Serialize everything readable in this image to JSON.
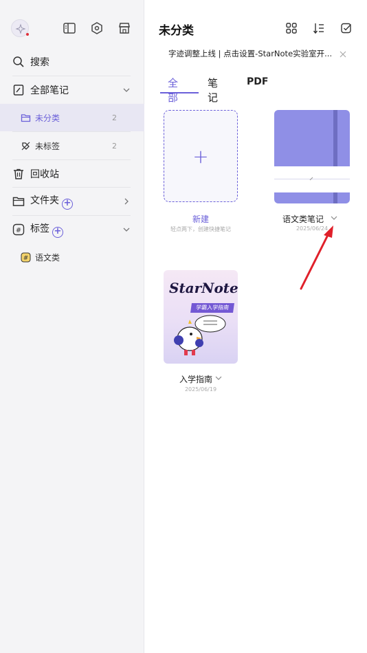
{
  "sidebar": {
    "search_label": "搜索",
    "all_notes_label": "全部笔记",
    "uncategorized": {
      "label": "未分类",
      "count": "2"
    },
    "unlabeled": {
      "label": "未标签",
      "count": "2"
    },
    "trash_label": "回收站",
    "folders_label": "文件夹",
    "tags_label": "标签",
    "tag_items": [
      {
        "label": "语文类"
      }
    ]
  },
  "header": {
    "title": "未分类",
    "banner_text": "字迹调整上线 | 点击设置-StarNote实验室开..."
  },
  "tabs": [
    {
      "label": "全部",
      "active": true
    },
    {
      "label": "笔记",
      "active": false
    },
    {
      "label": "PDF",
      "active": false
    }
  ],
  "cards": {
    "new": {
      "title": "新建",
      "hint": "轻点两下，创建快捷笔记"
    },
    "notebook": {
      "title": "语文类笔记",
      "date": "2025/06/24"
    },
    "guide": {
      "title": "入学指南",
      "date": "2025/06/19",
      "logo_text": "StarNote",
      "ribbon_text": "学霸入学指南"
    }
  },
  "colors": {
    "accent": "#6a5fd9",
    "notebook_cover": "#8f8fe6",
    "annotation_arrow": "#e0202a"
  }
}
